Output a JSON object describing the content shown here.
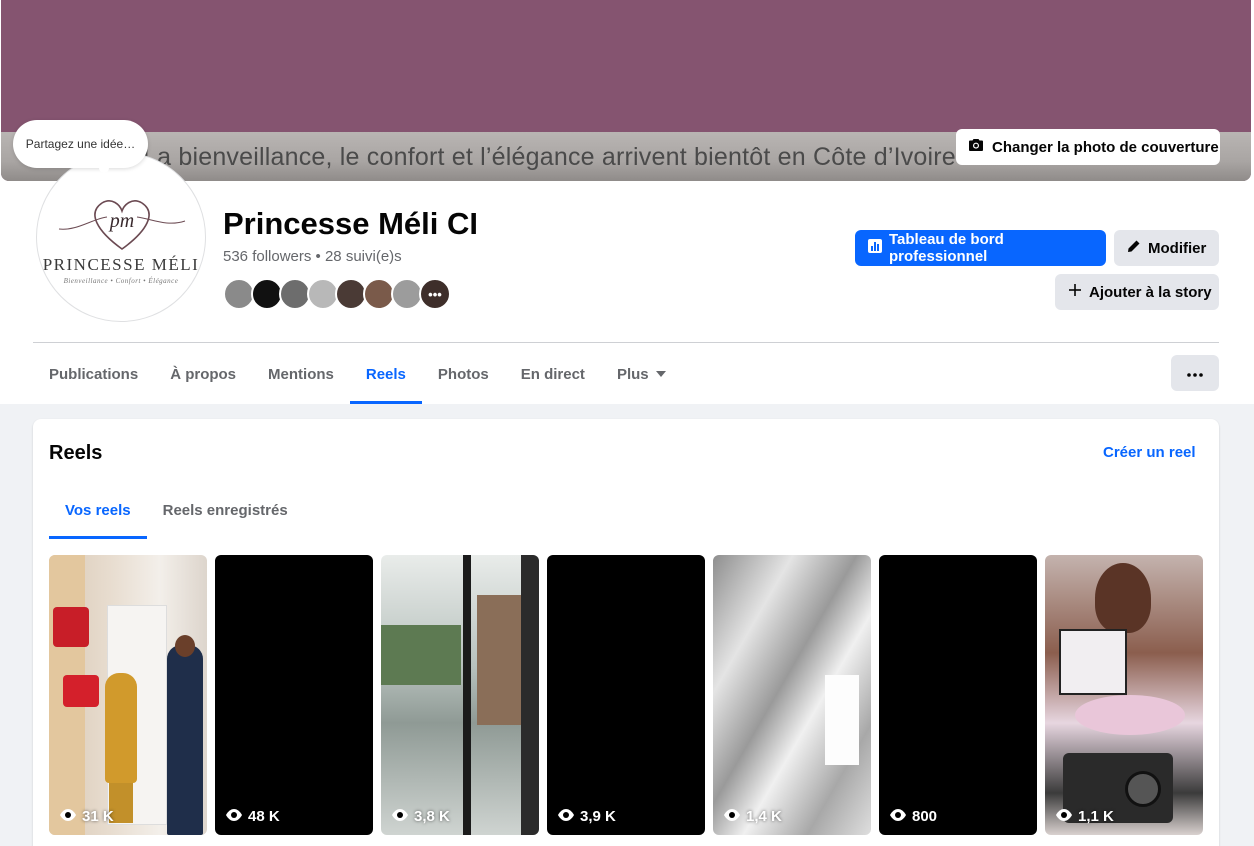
{
  "cover": {
    "text": "La bienveillance, le confort et l’élégance arrivent bientôt en Côte d’Ivoire",
    "change_button": "Changer la photo de couverture",
    "bg_color": "#855470"
  },
  "idea_bubble": "Partagez une idée…",
  "avatar": {
    "brand": "PRINCESSE MÉLI",
    "monogram": "pm",
    "tagline": "Bienveillance  •  Confort  •  Élégance"
  },
  "profile": {
    "name": "Princesse Méli CI",
    "stats": "536 followers • 28 suivi(e)s",
    "follower_avatars": [
      "#8a8a8a",
      "#111111",
      "#6d6d6d",
      "#b8b8b8",
      "#4a3a35",
      "#7a5a4a",
      "#9c9c9c",
      "#3e2e2a"
    ],
    "follower_more": "•••"
  },
  "actions": {
    "dashboard": "Tableau de bord professionnel",
    "edit": "Modifier",
    "add_story": "Ajouter à la story"
  },
  "tabs": [
    {
      "label": "Publications"
    },
    {
      "label": "À propos"
    },
    {
      "label": "Mentions"
    },
    {
      "label": "Reels",
      "active": true
    },
    {
      "label": "Photos"
    },
    {
      "label": "En direct"
    },
    {
      "label": "Plus"
    }
  ],
  "more_button": "•••",
  "reels_section": {
    "title": "Reels",
    "create": "Créer un reel",
    "subtabs": [
      {
        "label": "Vos reels",
        "active": true
      },
      {
        "label": "Reels enregistrés"
      }
    ],
    "items": [
      {
        "views": "31 K"
      },
      {
        "views": "48 K"
      },
      {
        "views": "3,8 K"
      },
      {
        "views": "3,9 K"
      },
      {
        "views": "1,4 K"
      },
      {
        "views": "800"
      },
      {
        "views": "1,1 K"
      }
    ]
  },
  "colors": {
    "accent": "#0866ff",
    "secondary_button": "#e4e6eb",
    "page_bg": "#f0f2f5"
  }
}
